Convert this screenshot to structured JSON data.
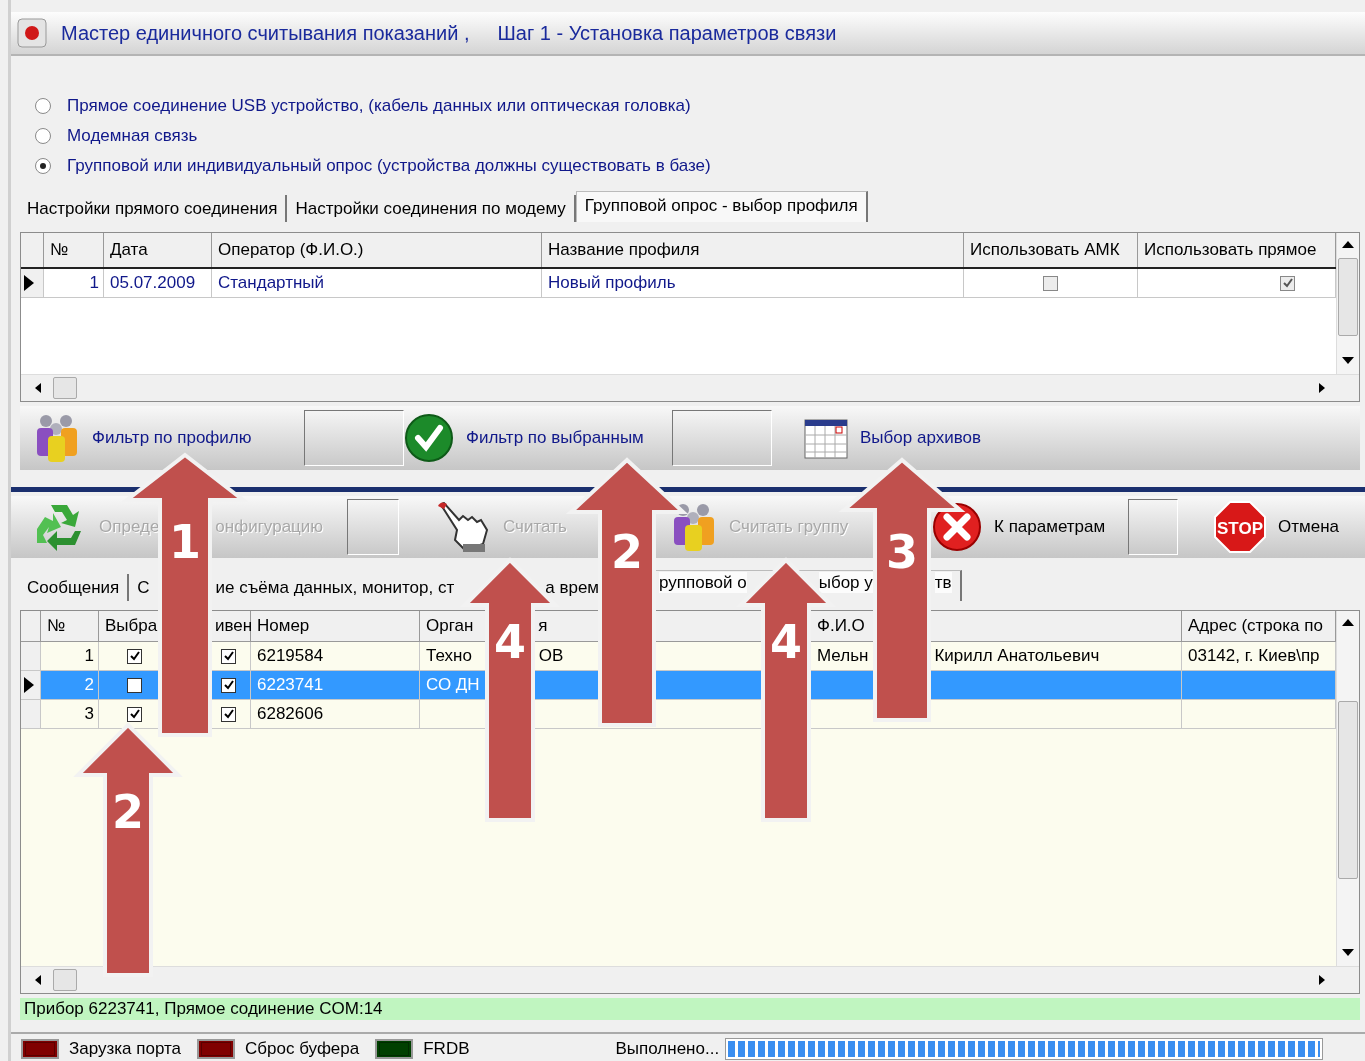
{
  "window": {
    "title": "Мастер единичного считывания показаний ,",
    "step": "Шаг 1 - Установка параметров связи"
  },
  "connection_modes": [
    {
      "label": "Прямое соединение USB устройство, (кабель данных или оптическая головка)",
      "selected": false
    },
    {
      "label": "Модемная связь",
      "selected": false
    },
    {
      "label": "Групповой или индивидуальный опрос (устройства должны существовать в базе)",
      "selected": true
    }
  ],
  "settings_tabs": [
    {
      "label": "Настройки прямого соединения",
      "selected": false
    },
    {
      "label": "Настройки соединения по модему",
      "selected": false
    },
    {
      "label": "Групповой опрос - выбор профиля",
      "selected": true
    }
  ],
  "profiles_table": {
    "columns": [
      "№",
      "Дата",
      "Оператор (Ф.И.О.)",
      "Название профиля",
      "Использовать АМК",
      "Использовать прямое"
    ],
    "rows": [
      {
        "current": true,
        "no": "1",
        "date": "05.07.2009",
        "operator": "Стандартный",
        "profile": "Новый профиль",
        "use_amk": false,
        "use_direct": true
      }
    ]
  },
  "profile_toolbar": [
    {
      "kind": "people",
      "parts": [
        "Фильтр по профилю"
      ]
    },
    {
      "kind": "panel"
    },
    {
      "kind": "check",
      "parts": [
        "Фильтр по выбранным"
      ]
    },
    {
      "kind": "panel"
    },
    {
      "kind": "calendar",
      "parts": [
        "Выбор архивов"
      ]
    }
  ],
  "action_toolbar": [
    {
      "kind": "recycle",
      "parts": [
        "Опреде",
        "онфигурацию"
      ],
      "disabled": true
    },
    {
      "kind": "panel"
    },
    {
      "kind": "hand",
      "parts": [
        "Считать"
      ],
      "disabled": true
    },
    {
      "kind": "people",
      "parts": [
        "Считать группу"
      ],
      "disabled": true
    },
    {
      "kind": "cross",
      "parts": [
        "К параметрам"
      ],
      "disabled": false
    },
    {
      "kind": "panel"
    },
    {
      "kind": "stop",
      "icon_text": "STOP",
      "parts": [
        "Отмена"
      ],
      "disabled": false
    }
  ],
  "lower_tabs": [
    {
      "parts": [
        "Сообщения"
      ],
      "selected": false
    },
    {
      "parts": [
        "С",
        "ие съёма данных, монитор, ст",
        "а врем"
      ],
      "selected": false
    },
    {
      "parts": [
        "рупповой о",
        "ыбор у",
        "тв"
      ],
      "cut_start": true,
      "selected": true
    }
  ],
  "devices_table": {
    "columns": [
      {
        "parts": [
          "№"
        ]
      },
      {
        "parts": [
          "Выбра"
        ]
      },
      {
        "parts": [
          "ивен"
        ],
        "cut_start": true
      },
      {
        "parts": [
          "Номер"
        ]
      },
      {
        "parts": [
          "Орган",
          "я"
        ]
      },
      {
        "parts": [
          "Ф.И.О"
        ]
      },
      {
        "parts": [
          "Адрес (строка по"
        ]
      }
    ],
    "rows": [
      {
        "current": false,
        "selected": false,
        "no": "1",
        "chosen": true,
        "active": true,
        "number": "6219584",
        "organization": [
          "Техно",
          "ОВ"
        ],
        "person": [
          "Мельн",
          "Кирилл Анатольевич"
        ],
        "address": "03142, г. Киев\\пр"
      },
      {
        "current": true,
        "selected": true,
        "no": "2",
        "chosen": false,
        "active": true,
        "number": "6223741",
        "organization": [
          "СО ДН"
        ]
      },
      {
        "current": false,
        "selected": false,
        "no": "3",
        "chosen": true,
        "active": true,
        "number": "6282606"
      }
    ]
  },
  "status_line": "Прибор 6223741, Прямое содинение COM:14",
  "indicators": [
    {
      "label": "Зарузка порта",
      "color": "#800000"
    },
    {
      "label": "Сброс буфера",
      "color": "#800000"
    },
    {
      "label": "FRDB",
      "color": "#004000"
    }
  ],
  "progress": {
    "label": "Выполнено...",
    "level": 1
  },
  "annotations": [
    {
      "label": "1"
    },
    {
      "label": "2"
    },
    {
      "label": "3"
    },
    {
      "label": "4"
    },
    {
      "label": "4"
    },
    {
      "label": "2"
    }
  ]
}
